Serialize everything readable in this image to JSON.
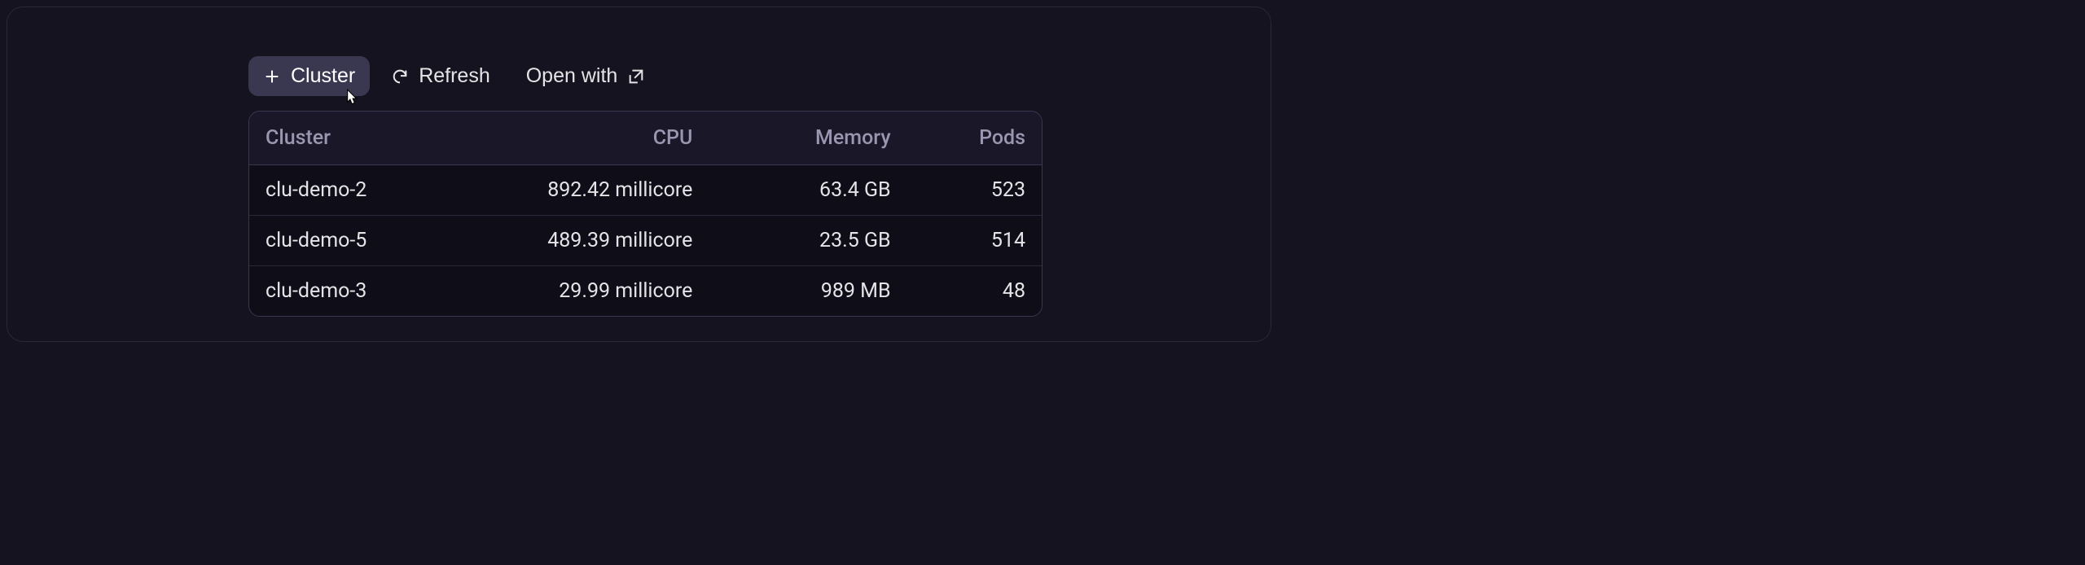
{
  "toolbar": {
    "cluster_label": "Cluster",
    "refresh_label": "Refresh",
    "openwith_label": "Open with"
  },
  "table": {
    "headers": {
      "cluster": "Cluster",
      "cpu": "CPU",
      "memory": "Memory",
      "pods": "Pods"
    },
    "rows": [
      {
        "cluster": "clu-demo-2",
        "cpu": "892.42 millicore",
        "memory": "63.4 GB",
        "pods": "523"
      },
      {
        "cluster": "clu-demo-5",
        "cpu": "489.39 millicore",
        "memory": "23.5 GB",
        "pods": "514"
      },
      {
        "cluster": "clu-demo-3",
        "cpu": "29.99 millicore",
        "memory": "989 MB",
        "pods": "48"
      }
    ]
  }
}
